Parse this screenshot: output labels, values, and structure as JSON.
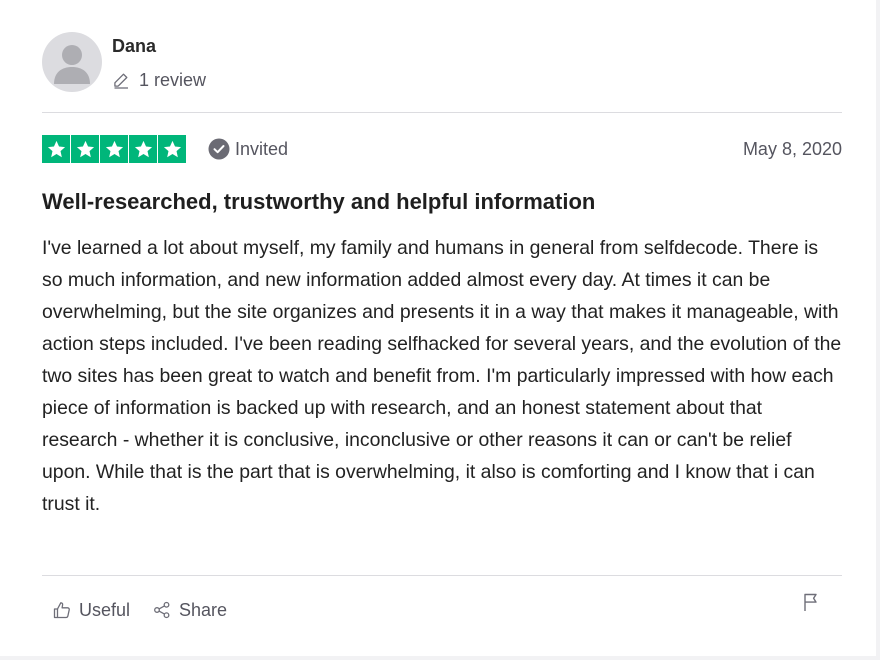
{
  "reviewer": {
    "name": "Dana",
    "review_count": "1 review",
    "avatar_icon": "default-user-avatar-icon",
    "review_count_icon": "pencil-icon"
  },
  "review": {
    "rating": 5,
    "max_rating": 5,
    "star_icon": "star-icon",
    "star_color": "#00b67a",
    "invited_label": "Invited",
    "invited_icon": "check-circle-icon",
    "date": "May 8, 2020",
    "title": "Well-researched, trustworthy and helpful information",
    "body": "I've learned a lot about myself, my family and humans in general from selfdecode. There is so much information, and new information added almost every day. At times it can be overwhelming, but the site organizes and presents it in a way that makes it manageable, with action steps included. I've been reading selfhacked for several years, and the evolution of the two sites has been great to watch and benefit from. I'm particularly impressed with how each piece of information is backed up with research, and an honest statement about that research - whether it is conclusive, inconclusive or other reasons it can or can't be relief upon. While that is the part that is overwhelming, it also is comforting and I know that i can trust it."
  },
  "actions": {
    "useful_label": "Useful",
    "useful_icon": "thumbs-up-icon",
    "share_label": "Share",
    "share_icon": "share-icon",
    "report_icon": "flag-icon"
  }
}
